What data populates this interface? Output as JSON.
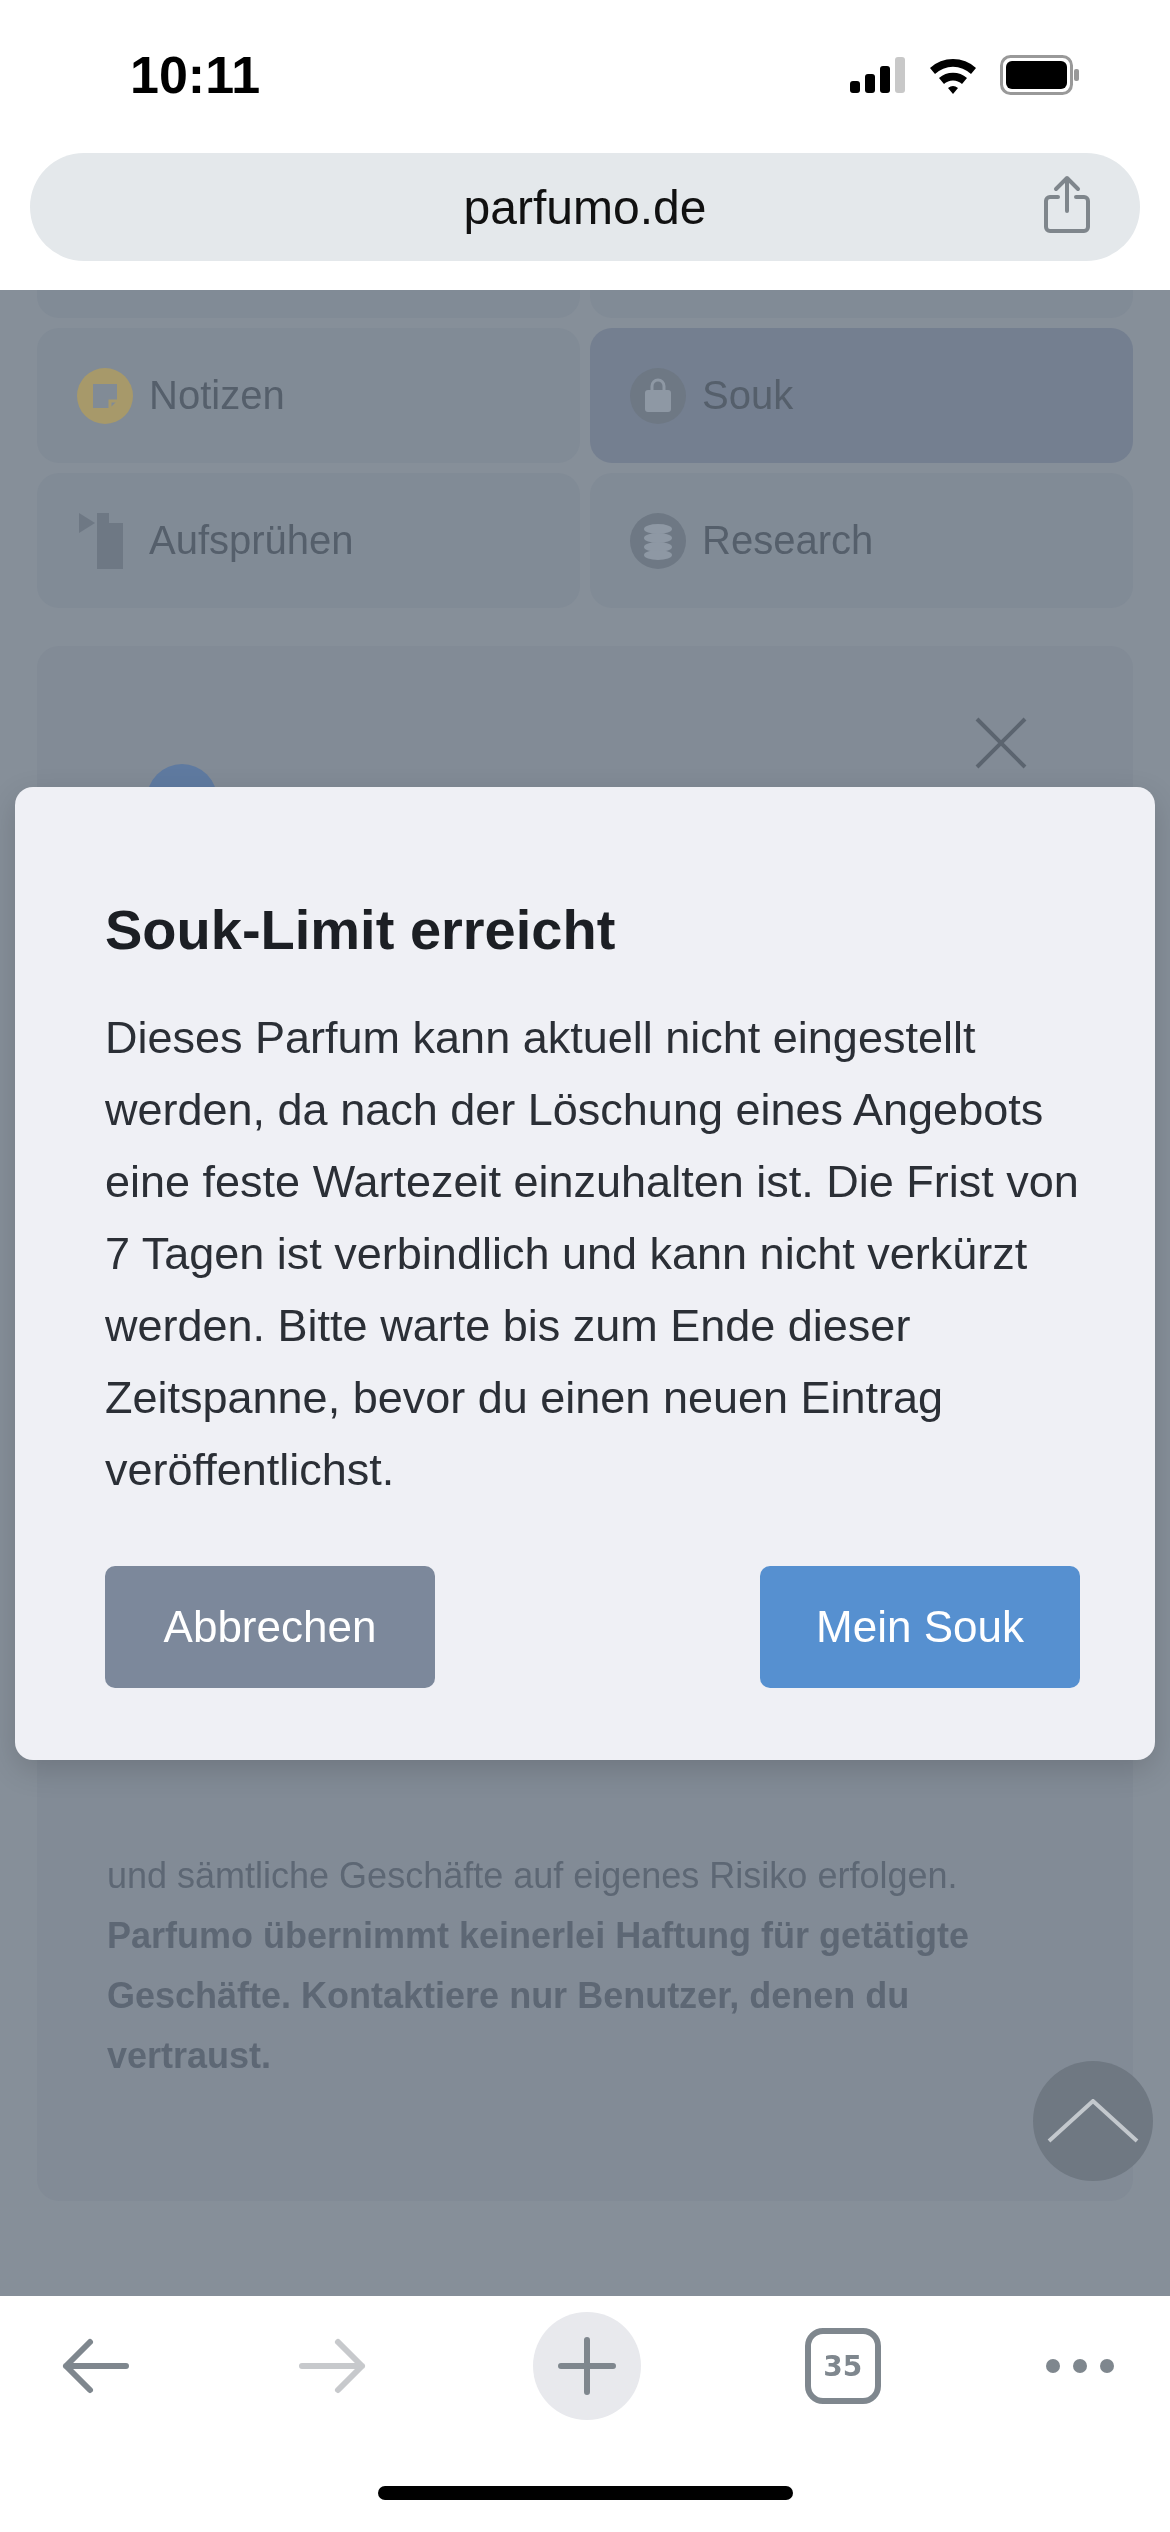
{
  "status_bar": {
    "time": "10:11"
  },
  "address_bar": {
    "url": "parfumo.de"
  },
  "menu_tiles": [
    {
      "label": "Notizen",
      "kind": "notes",
      "selected": false
    },
    {
      "label": "Souk",
      "kind": "bag",
      "selected": true
    },
    {
      "label": "Aufsprühen",
      "kind": "spray",
      "selected": false
    },
    {
      "label": "Research",
      "kind": "database",
      "selected": false
    }
  ],
  "panel": {
    "notice": "und sämtliche Geschäfte auf eigenes Risiko erfolgen. **Parfumo übernimmt keinerlei Haftung für getätigte Geschäfte. Kontaktiere nur Benutzer, denen du vertraust.**"
  },
  "dialog": {
    "title": "Souk-Limit erreicht",
    "message": "Dieses Parfum kann aktuell nicht eingestellt werden, da nach der Löschung eines Angebots eine feste Wartezeit einzuhalten ist. Die Frist von 7 Tagen ist verbindlich und kann nicht verkürzt werden. Bitte warte bis zum Ende dieser Zeitspanne, bevor du einen neuen Eintrag veröffentlichst.",
    "buttons": [
      {
        "label": "Abbrechen",
        "kind": "secondary"
      },
      {
        "label": "Mein Souk",
        "kind": "primary"
      }
    ]
  },
  "toolbar": {
    "back_enabled": true,
    "forward_enabled": false,
    "tab_count": "35"
  }
}
